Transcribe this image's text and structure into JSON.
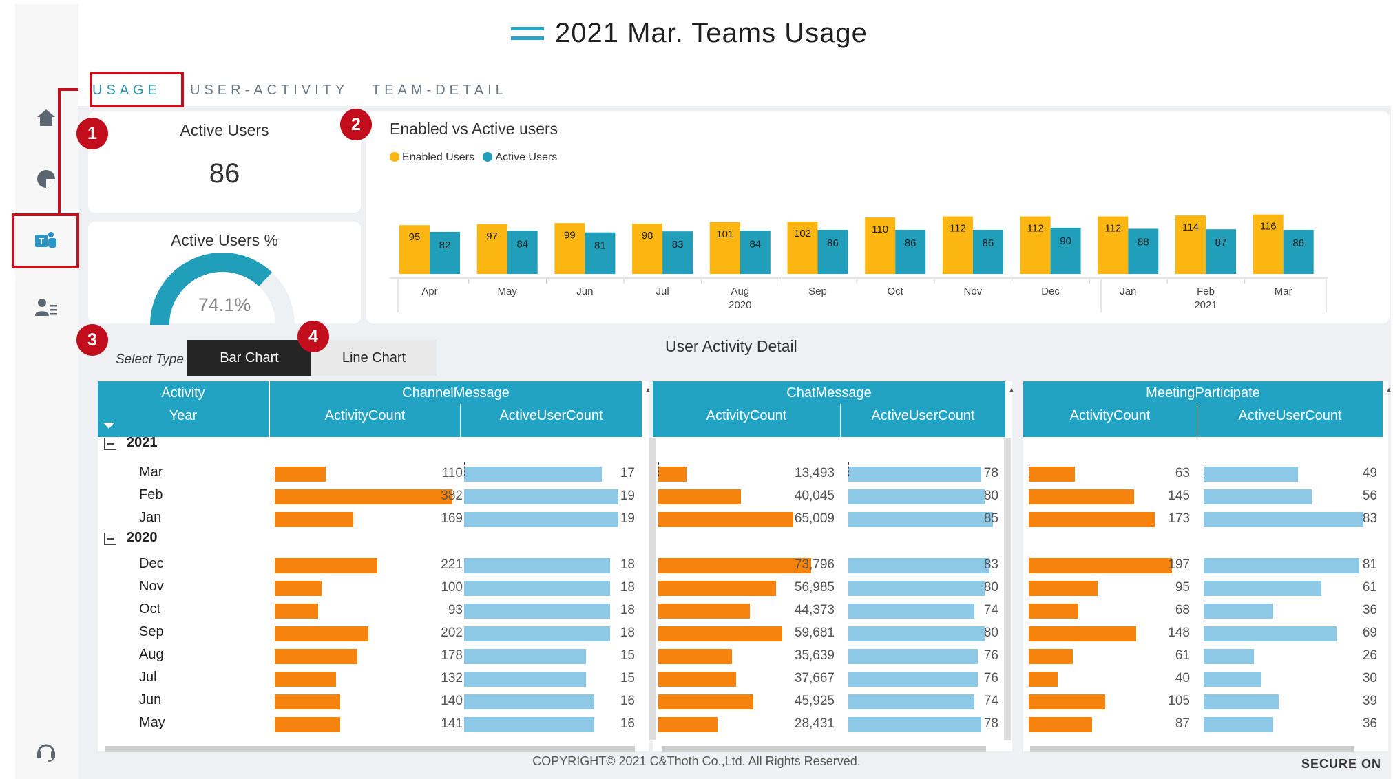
{
  "title": "2021 Mar. Teams Usage",
  "tabs": [
    {
      "label": "USAGE",
      "active": true
    },
    {
      "label": "USER-ACTIVITY",
      "active": false
    },
    {
      "label": "TEAM-DETAIL",
      "active": false
    }
  ],
  "sidebar": {
    "icons": [
      "home-icon",
      "pie-chart-icon",
      "teams-icon",
      "user-list-icon",
      "headset-icon"
    ],
    "selected": "teams-icon"
  },
  "callouts": [
    "1",
    "2",
    "3",
    "4"
  ],
  "kpi_active_users": {
    "title": "Active Users",
    "value": "86"
  },
  "kpi_active_pct": {
    "title": "Active Users %",
    "value": "74.1%",
    "fraction": 0.741
  },
  "enabled_vs_active": {
    "title": "Enabled vs Active users",
    "legend": [
      "Enabled Users",
      "Active Users"
    ],
    "colors": {
      "enabled": "#fbb612",
      "active": "#219eba"
    }
  },
  "chart_data": {
    "type": "bar",
    "title": "Enabled vs Active users",
    "categories": [
      "Apr",
      "May",
      "Jun",
      "Jul",
      "Aug",
      "Sep",
      "Oct",
      "Nov",
      "Dec",
      "Jan",
      "Feb",
      "Mar"
    ],
    "year_labels": [
      {
        "category": "Aug",
        "label": "2020"
      },
      {
        "category": "Feb",
        "label": "2021"
      }
    ],
    "series": [
      {
        "name": "Enabled Users",
        "values": [
          95,
          97,
          99,
          98,
          101,
          102,
          110,
          112,
          112,
          112,
          114,
          116
        ]
      },
      {
        "name": "Active Users",
        "values": [
          82,
          84,
          81,
          83,
          84,
          86,
          86,
          86,
          90,
          88,
          87,
          86
        ]
      }
    ],
    "ylim": [
      0,
      120
    ]
  },
  "select_type": {
    "label": "Select Type :",
    "options": [
      "Bar Chart",
      "Line Chart"
    ],
    "selected": "Bar Chart"
  },
  "detail": {
    "title": "User Activity Detail",
    "row_header_top": "Activity",
    "row_header_bottom": "Year",
    "groups": [
      "ChannelMessage",
      "ChatMessage",
      "MeetingParticipate"
    ],
    "subcols": [
      "ActivityCount",
      "ActiveUserCount"
    ],
    "years": [
      {
        "year": "2021",
        "months": [
          "Mar",
          "Feb",
          "Jan"
        ]
      },
      {
        "year": "2020",
        "months": [
          "Dec",
          "Nov",
          "Oct",
          "Sep",
          "Aug",
          "Jul",
          "Jun",
          "May"
        ]
      }
    ],
    "rows": [
      {
        "month": "Mar",
        "ch_act": "110",
        "ch_usr": "17",
        "chat_act": "13,493",
        "chat_usr": "78",
        "meet_act": "63",
        "meet_usr": "49"
      },
      {
        "month": "Feb",
        "ch_act": "382",
        "ch_usr": "19",
        "chat_act": "40,045",
        "chat_usr": "80",
        "meet_act": "145",
        "meet_usr": "56"
      },
      {
        "month": "Jan",
        "ch_act": "169",
        "ch_usr": "19",
        "chat_act": "65,009",
        "chat_usr": "85",
        "meet_act": "173",
        "meet_usr": "83"
      },
      {
        "month": "Dec",
        "ch_act": "221",
        "ch_usr": "18",
        "chat_act": "73,796",
        "chat_usr": "83",
        "meet_act": "197",
        "meet_usr": "81"
      },
      {
        "month": "Nov",
        "ch_act": "100",
        "ch_usr": "18",
        "chat_act": "56,985",
        "chat_usr": "80",
        "meet_act": "95",
        "meet_usr": "61"
      },
      {
        "month": "Oct",
        "ch_act": "93",
        "ch_usr": "18",
        "chat_act": "44,373",
        "chat_usr": "74",
        "meet_act": "68",
        "meet_usr": "36"
      },
      {
        "month": "Sep",
        "ch_act": "202",
        "ch_usr": "18",
        "chat_act": "59,681",
        "chat_usr": "80",
        "meet_act": "148",
        "meet_usr": "69"
      },
      {
        "month": "Aug",
        "ch_act": "178",
        "ch_usr": "15",
        "chat_act": "35,639",
        "chat_usr": "76",
        "meet_act": "61",
        "meet_usr": "26"
      },
      {
        "month": "Jul",
        "ch_act": "132",
        "ch_usr": "15",
        "chat_act": "37,667",
        "chat_usr": "76",
        "meet_act": "40",
        "meet_usr": "30"
      },
      {
        "month": "Jun",
        "ch_act": "140",
        "ch_usr": "16",
        "chat_act": "45,925",
        "chat_usr": "74",
        "meet_act": "105",
        "meet_usr": "39"
      },
      {
        "month": "May",
        "ch_act": "141",
        "ch_usr": "16",
        "chat_act": "28,431",
        "chat_usr": "78",
        "meet_act": "87",
        "meet_usr": "36"
      }
    ]
  },
  "footer": "COPYRIGHT© 2021 C&Thoth Co.,Ltd. All Rights Reserved.",
  "brand": "SECURE ON",
  "colors": {
    "teal": "#23a3c3",
    "orange": "#f6830e",
    "lightblue": "#8dc9e7",
    "red": "#c20d1c",
    "gold": "#fbb612"
  }
}
